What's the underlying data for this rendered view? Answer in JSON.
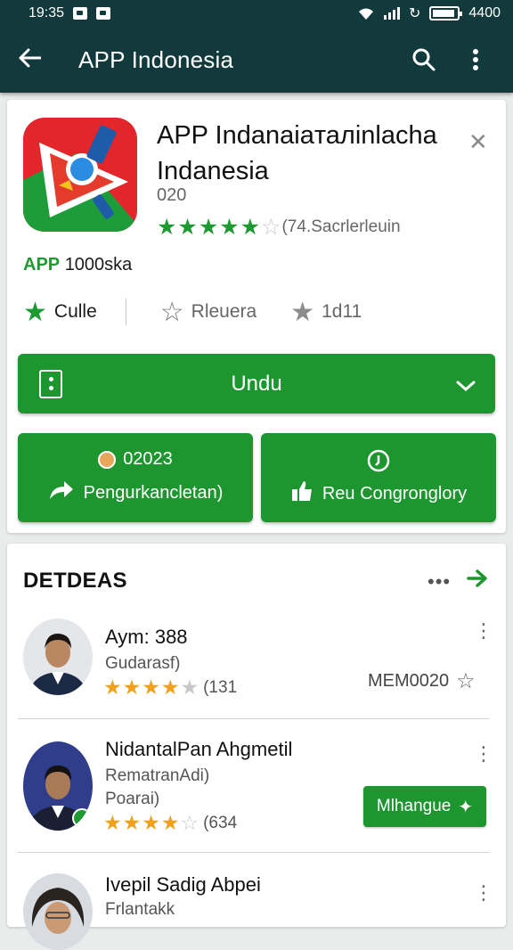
{
  "status_bar": {
    "time": "19:35",
    "right_text": "4400"
  },
  "appbar": {
    "title": "APP Indonesia"
  },
  "app": {
    "title": "APP Indanaiaталinlacha Indanesia",
    "version": "020",
    "rating_count": "(74.Sacrlerleuin",
    "tag_prefix": "APP",
    "tag_suffix": "1000ska",
    "stats": {
      "first": "Culle",
      "second": "Rleuera",
      "third": "1d11"
    }
  },
  "buttons": {
    "download": "Undu",
    "left_top": "02023",
    "left_bottom": "Pengurkancletan)",
    "right_bottom": "Reu Congronglory"
  },
  "list": {
    "heading": "DETDEAS",
    "items": [
      {
        "name": "Aym: 388",
        "sub1": "Gudarasf)",
        "count": "(131",
        "meta": "MEM0020"
      },
      {
        "name": "NidantalPan Ahgmetil",
        "sub1": "RematranAdi)",
        "sub2": "Poarai)",
        "count": "(634",
        "action": "Mlhangue"
      },
      {
        "name": "Ivepil Sadig Abpei",
        "sub1": "Frlantakk"
      }
    ]
  },
  "colors": {
    "primary_dark": "#123a3d",
    "accent_green": "#1e9630",
    "star_orange": "#f2a01b"
  }
}
